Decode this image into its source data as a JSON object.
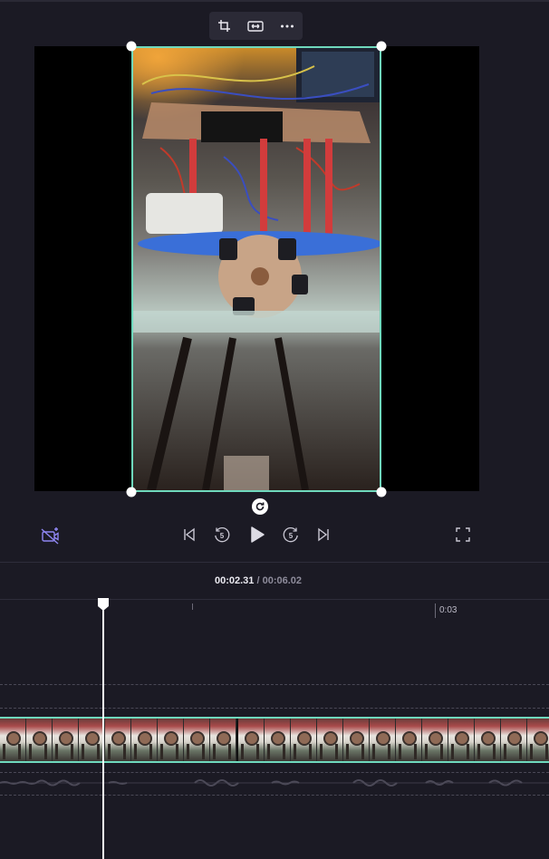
{
  "toolbar": {
    "crop_icon": "crop-icon",
    "fit_icon": "fit-width-icon",
    "more_icon": "more-icon"
  },
  "controls": {
    "ai_icon": "ai-camera-icon",
    "skip_back_icon": "skip-to-start-icon",
    "rewind_icon": "rewind-5-icon",
    "rewind_label": "5",
    "play_icon": "play-icon",
    "forward_icon": "forward-5-icon",
    "forward_label": "5",
    "skip_forward_icon": "skip-to-end-icon",
    "fullscreen_icon": "fullscreen-icon"
  },
  "timeline": {
    "current_time": "00:02.31",
    "separator": " / ",
    "total_duration": "00:06.02",
    "ruler_labels": [
      "0:03"
    ]
  },
  "colors": {
    "background": "#1b1a24",
    "accent": "#6fd9bd",
    "ai_purple": "#8f86f2"
  }
}
